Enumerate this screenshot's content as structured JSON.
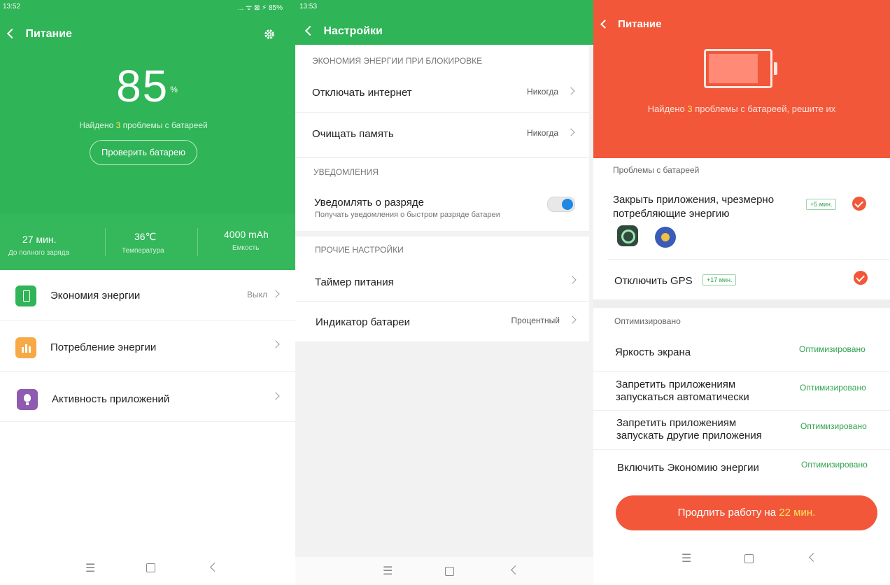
{
  "panel1": {
    "status": {
      "time": "13:52",
      "icons": "... ᯤ ⊠ ⚡ 85%"
    },
    "header": {
      "title": "Питание"
    },
    "battery": {
      "percent": "85",
      "unit": "%"
    },
    "problems": {
      "prefix": "Найдено ",
      "count": "3",
      "suffix": " проблемы с батареей"
    },
    "check_button": "Проверить батарею",
    "stats": [
      {
        "value": "27 мин.",
        "label": "До полного заряда"
      },
      {
        "value": "36℃",
        "label": "Температура"
      },
      {
        "value": "4000 mAh",
        "label": "Емкость"
      }
    ],
    "menu": [
      {
        "label": "Экономия энергии",
        "value": "Выкл",
        "icon": "battery-save-icon",
        "color": "#2fb457"
      },
      {
        "label": "Потребление энергии",
        "value": "",
        "icon": "bar-chart-icon",
        "color": "#f7a946"
      },
      {
        "label": "Активность приложений",
        "value": "",
        "icon": "lightbulb-icon",
        "color": "#8e5bb0"
      }
    ]
  },
  "panel2": {
    "status": {
      "time": "13:53"
    },
    "header": {
      "title": "Настройки"
    },
    "sections": {
      "lock_saving": "ЭКОНОМИЯ ЭНЕРГИИ ПРИ БЛОКИРОВКЕ",
      "notifications": "УВЕДОМЛЕНИЯ",
      "other": "ПРОЧИЕ НАСТРОЙКИ"
    },
    "rows": {
      "disable_internet": {
        "label": "Отключать интернет",
        "value": "Никогда"
      },
      "clear_memory": {
        "label": "Очищать память",
        "value": "Никогда"
      },
      "notify_drain": {
        "label": "Уведомлять о разряде",
        "sub": "Получать уведомления о быстром разряде батареи",
        "enabled": true
      },
      "power_timer": {
        "label": "Таймер питания"
      },
      "battery_indicator": {
        "label": "Индикатор батареи",
        "value": "Процентный"
      }
    }
  },
  "panel3": {
    "header": {
      "title": "Питание"
    },
    "message": {
      "prefix": "Найдено ",
      "count": "3",
      "suffix": " проблемы с батареей, решите их"
    },
    "problems_title": "Проблемы с батареей",
    "problems": [
      {
        "label_line1": "Закрыть приложения, чрезмерно",
        "label_line2": "потребляющие энергию",
        "tag": "+5 мин."
      },
      {
        "label_line1": "Отключить GPS",
        "tag": "+17 мин."
      }
    ],
    "optimized_title": "Оптимизировано",
    "optimized": [
      {
        "line1": "Яркость экрана",
        "line2": "",
        "status": "Оптимизировано"
      },
      {
        "line1": "Запретить приложениям",
        "line2": "запускаться автоматически",
        "status": "Оптимизировано"
      },
      {
        "line1": "Запретить приложениям",
        "line2": "запускать другие приложения",
        "status": "Оптимизировано"
      },
      {
        "line1": "Включить Экономию энергии",
        "line2": "",
        "status": "Оптимизировано"
      }
    ],
    "extend_button": {
      "prefix": "Продлить работу на ",
      "value": "22 мин."
    }
  },
  "colors": {
    "green": "#2fb457",
    "red": "#f2573a",
    "blue": "#1e88e5",
    "yellow": "#ffe55c"
  }
}
